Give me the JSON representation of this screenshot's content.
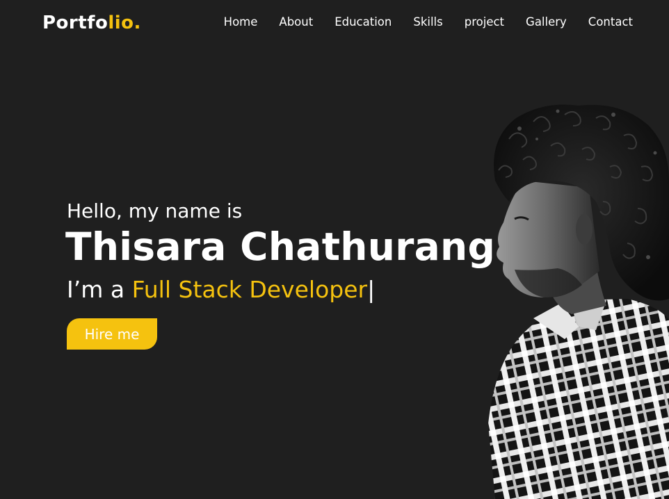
{
  "header": {
    "logo_main": "Portfo",
    "logo_accent": "lio.",
    "nav": [
      "Home",
      "About",
      "Education",
      "Skills",
      "project",
      "Gallery",
      "Contact"
    ]
  },
  "hero": {
    "greeting": "Hello, my name is",
    "name": "Thisara Chathuranga",
    "role_prefix": "I’m a ",
    "role_typed": "Full Stack Developer",
    "cursor": "|",
    "hire_label": "Hire me"
  },
  "colors": {
    "background": "#1f1f1f",
    "accent": "#f5c20f",
    "text": "#ffffff"
  },
  "portrait": {
    "icon": "person-portrait-photo"
  }
}
